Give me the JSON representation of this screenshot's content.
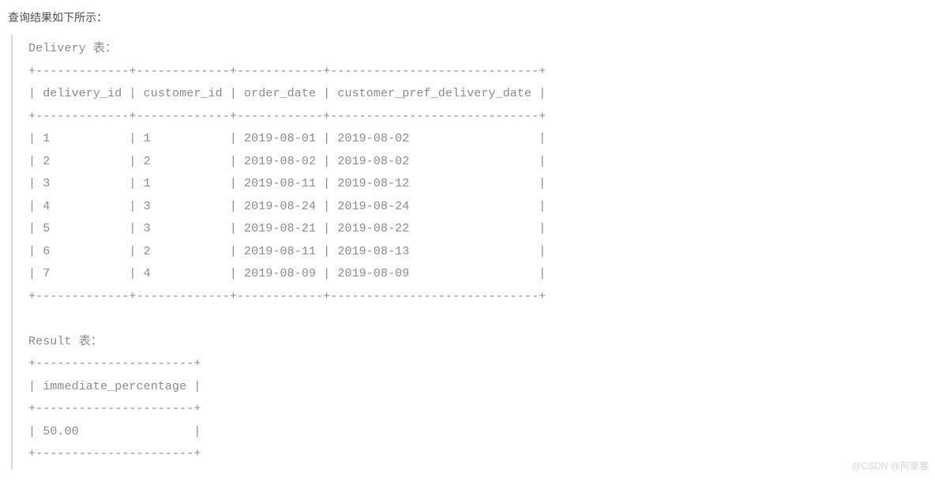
{
  "heading": "查询结果如下所示：",
  "delivery_title": "Delivery 表：",
  "delivery_cols": [
    "delivery_id",
    "customer_id",
    "order_date",
    "customer_pref_delivery_date"
  ],
  "delivery_rows": [
    [
      "1",
      "1",
      "2019-08-01",
      "2019-08-02"
    ],
    [
      "2",
      "2",
      "2019-08-02",
      "2019-08-02"
    ],
    [
      "3",
      "1",
      "2019-08-11",
      "2019-08-12"
    ],
    [
      "4",
      "3",
      "2019-08-24",
      "2019-08-24"
    ],
    [
      "5",
      "3",
      "2019-08-21",
      "2019-08-22"
    ],
    [
      "6",
      "2",
      "2019-08-11",
      "2019-08-13"
    ],
    [
      "7",
      "4",
      "2019-08-09",
      "2019-08-09"
    ]
  ],
  "result_title": "Result 表：",
  "result_cols": [
    "immediate_percentage"
  ],
  "result_rows": [
    [
      "50.00"
    ]
  ],
  "col_widths": {
    "delivery": [
      13,
      13,
      12,
      29
    ],
    "result": [
      22
    ]
  },
  "watermark": "@CSDN @阿豪客"
}
